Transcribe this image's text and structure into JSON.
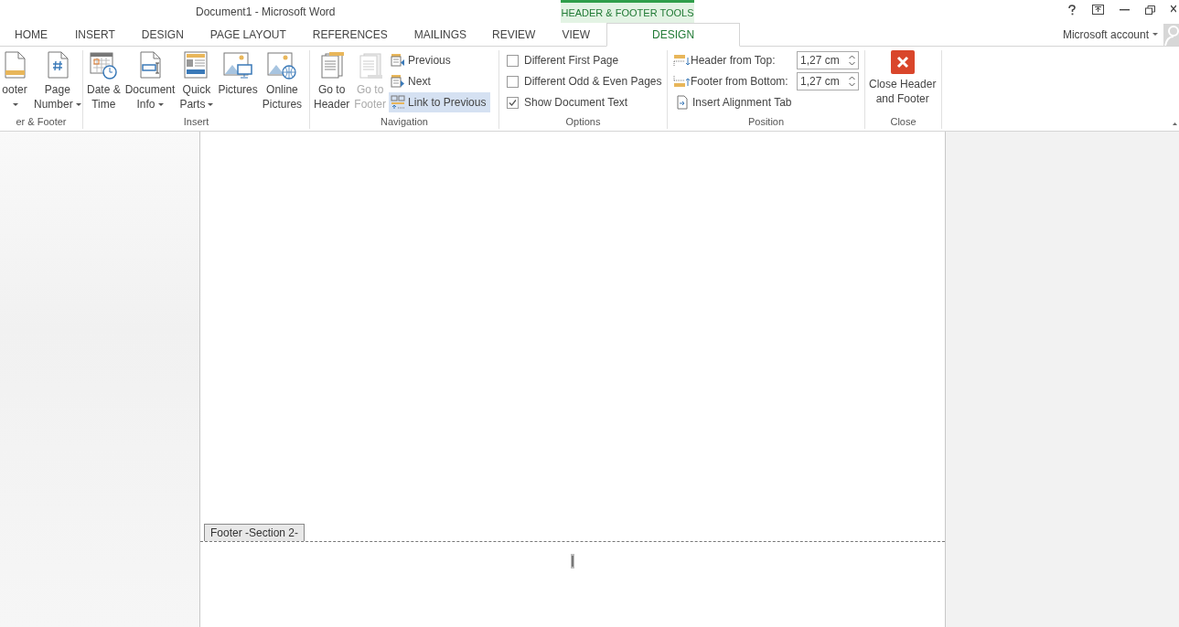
{
  "window": {
    "title": "Document1 - Microsoft Word",
    "contextual_label": "HEADER & FOOTER TOOLS",
    "account": "Microsoft account"
  },
  "tabs": [
    {
      "label": "HOME",
      "selected": false
    },
    {
      "label": "INSERT",
      "selected": false
    },
    {
      "label": "DESIGN",
      "selected": false
    },
    {
      "label": "PAGE LAYOUT",
      "selected": false
    },
    {
      "label": "REFERENCES",
      "selected": false
    },
    {
      "label": "MAILINGS",
      "selected": false
    },
    {
      "label": "REVIEW",
      "selected": false
    },
    {
      "label": "VIEW",
      "selected": false
    },
    {
      "label": "DESIGN",
      "selected": true
    }
  ],
  "ribbon": [
    {
      "label": "er & Footer",
      "items": [
        {
          "kind": "large",
          "lines": [
            "ooter"
          ],
          "dropdown": true,
          "disabled": false
        },
        {
          "kind": "large",
          "lines": [
            "Page",
            "Number"
          ],
          "dropdown": true,
          "disabled": false
        }
      ]
    },
    {
      "label": "Insert",
      "items": [
        {
          "kind": "large",
          "lines": [
            "Date &",
            "Time"
          ],
          "dropdown": false,
          "disabled": false
        },
        {
          "kind": "large",
          "lines": [
            "Document",
            "Info"
          ],
          "dropdown": true,
          "disabled": false
        },
        {
          "kind": "large",
          "lines": [
            "Quick",
            "Parts"
          ],
          "dropdown": true,
          "disabled": false
        },
        {
          "kind": "large",
          "lines": [
            "Pictures"
          ],
          "dropdown": false,
          "disabled": false
        },
        {
          "kind": "large",
          "lines": [
            "Online",
            "Pictures"
          ],
          "dropdown": false,
          "disabled": false
        }
      ]
    },
    {
      "label": "Navigation",
      "items": [
        {
          "kind": "large",
          "lines": [
            "Go to",
            "Header"
          ],
          "dropdown": false,
          "disabled": false
        },
        {
          "kind": "large",
          "lines": [
            "Go to",
            "Footer"
          ],
          "dropdown": false,
          "disabled": true
        },
        {
          "kind": "stack",
          "buttons": [
            {
              "label": "Previous",
              "selected": false
            },
            {
              "label": "Next",
              "selected": false
            },
            {
              "label": "Link to Previous",
              "selected": true
            }
          ]
        }
      ]
    },
    {
      "label": "Options",
      "items": [
        {
          "kind": "checks",
          "checks": [
            {
              "label": "Different First Page",
              "checked": false
            },
            {
              "label": "Different Odd & Even Pages",
              "checked": false
            },
            {
              "label": "Show Document Text",
              "checked": true
            }
          ]
        }
      ]
    },
    {
      "label": "Position",
      "items": [
        {
          "kind": "position",
          "spins": [
            {
              "label": "Header from Top:",
              "value": "1,27 cm"
            },
            {
              "label": "Footer from Bottom:",
              "value": "1,27 cm"
            }
          ],
          "button": "Insert Alignment Tab"
        }
      ]
    },
    {
      "label": "Close",
      "items": [
        {
          "kind": "close",
          "lines": [
            "Close Header",
            "and Footer"
          ],
          "dropdown": false,
          "disabled": false
        }
      ]
    }
  ],
  "document": {
    "footer_tag": "Footer -Section 2-"
  }
}
